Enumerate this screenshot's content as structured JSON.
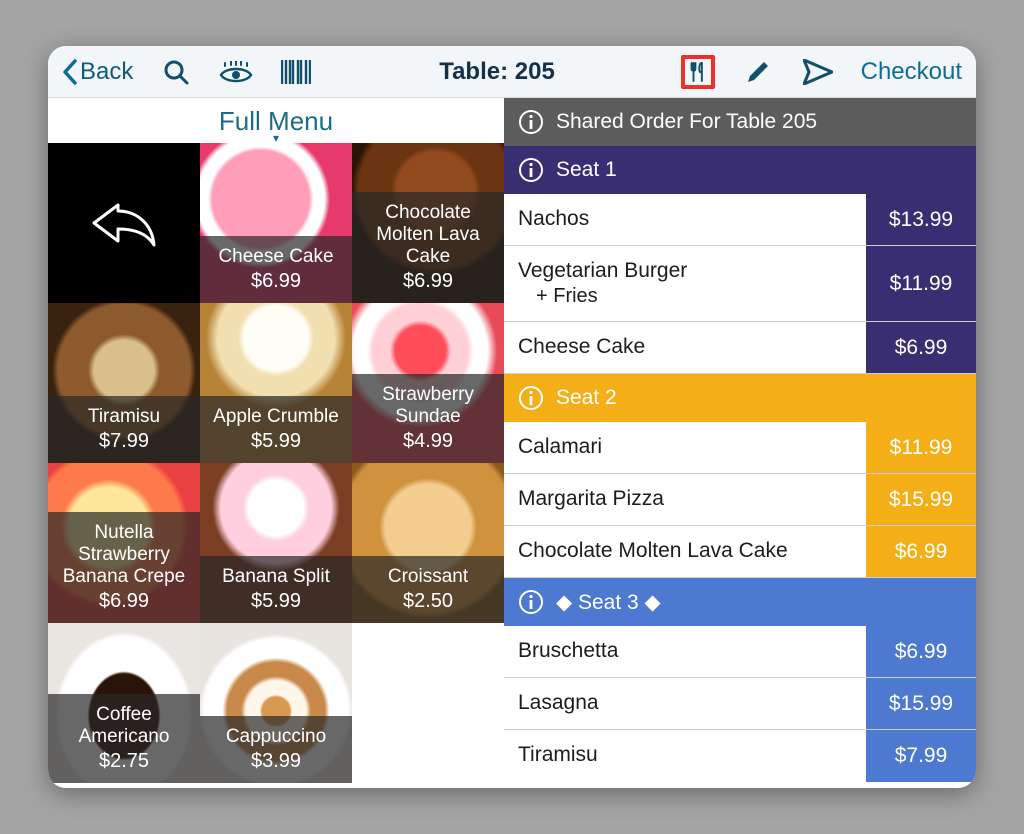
{
  "topbar": {
    "back_label": "Back",
    "title": "Table: 205",
    "checkout_label": "Checkout"
  },
  "menu": {
    "header": "Full Menu",
    "items": [
      {
        "name": "Cheese Cake",
        "price": "$6.99"
      },
      {
        "name": "Chocolate Molten Lava Cake",
        "price": "$6.99"
      },
      {
        "name": "Tiramisu",
        "price": "$7.99"
      },
      {
        "name": "Apple Crumble",
        "price": "$5.99"
      },
      {
        "name": "Strawberry Sundae",
        "price": "$4.99"
      },
      {
        "name": "Nutella Strawberry Banana Crepe",
        "price": "$6.99"
      },
      {
        "name": "Banana Split",
        "price": "$5.99"
      },
      {
        "name": "Croissant",
        "price": "$2.50"
      },
      {
        "name": "Coffee Americano",
        "price": "$2.75"
      },
      {
        "name": "Cappuccino",
        "price": "$3.99"
      }
    ]
  },
  "order_header": "Shared Order For Table 205",
  "seats": [
    {
      "label": "Seat 1",
      "color": "s1",
      "amt": "c1",
      "lines": [
        {
          "name": "Nachos",
          "mod": "",
          "price": "$13.99"
        },
        {
          "name": "Vegetarian Burger",
          "mod": "+ Fries",
          "price": "$11.99"
        },
        {
          "name": "Cheese Cake",
          "mod": "",
          "price": "$6.99"
        }
      ]
    },
    {
      "label": "Seat 2",
      "color": "s2",
      "amt": "c2",
      "lines": [
        {
          "name": "Calamari",
          "mod": "",
          "price": "$11.99"
        },
        {
          "name": "Margarita Pizza",
          "mod": "",
          "price": "$15.99"
        },
        {
          "name": "Chocolate Molten Lava Cake",
          "mod": "",
          "price": "$6.99"
        }
      ]
    },
    {
      "label": "◆  Seat 3  ◆",
      "color": "s3",
      "amt": "c3",
      "lines": [
        {
          "name": "Bruschetta",
          "mod": "",
          "price": "$6.99"
        },
        {
          "name": "Lasagna",
          "mod": "",
          "price": "$15.99"
        },
        {
          "name": "Tiramisu",
          "mod": "",
          "price": "$7.99"
        }
      ]
    }
  ]
}
